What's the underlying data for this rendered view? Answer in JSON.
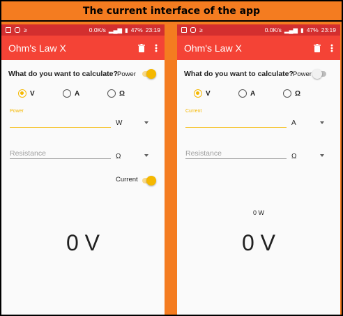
{
  "banner": {
    "title": "The current interface of the app"
  },
  "status": {
    "speed": "0.0K/s",
    "battery": "47%",
    "time": "23:19"
  },
  "app": {
    "title": "Ohm's Law X"
  },
  "colors": {
    "appbar": "#f44336",
    "statusbar": "#d32f2f",
    "accent": "#f5b800",
    "background": "#f47c20"
  },
  "left": {
    "question": "What do you want to calculate?",
    "power_toggle_label": "Power",
    "power_toggle_on": true,
    "radios": [
      {
        "label": "V",
        "checked": true
      },
      {
        "label": "A",
        "checked": false
      },
      {
        "label": "Ω",
        "checked": false
      }
    ],
    "field1_label": "Power",
    "field1_value": "",
    "field1_unit": "W",
    "field2_placeholder": "Resistance",
    "field2_unit": "Ω",
    "current_toggle_label": "Current",
    "current_toggle_on": true,
    "result": "0 V"
  },
  "right": {
    "question": "What do you want to calculate?",
    "power_toggle_label": "Power",
    "power_toggle_on": false,
    "radios": [
      {
        "label": "V",
        "checked": true
      },
      {
        "label": "A",
        "checked": false
      },
      {
        "label": "Ω",
        "checked": false
      }
    ],
    "field1_label": "Current",
    "field1_value": "",
    "field1_unit": "A",
    "field2_placeholder": "Resistance",
    "field2_unit": "Ω",
    "power_value": "0 W",
    "result": "0 V"
  }
}
